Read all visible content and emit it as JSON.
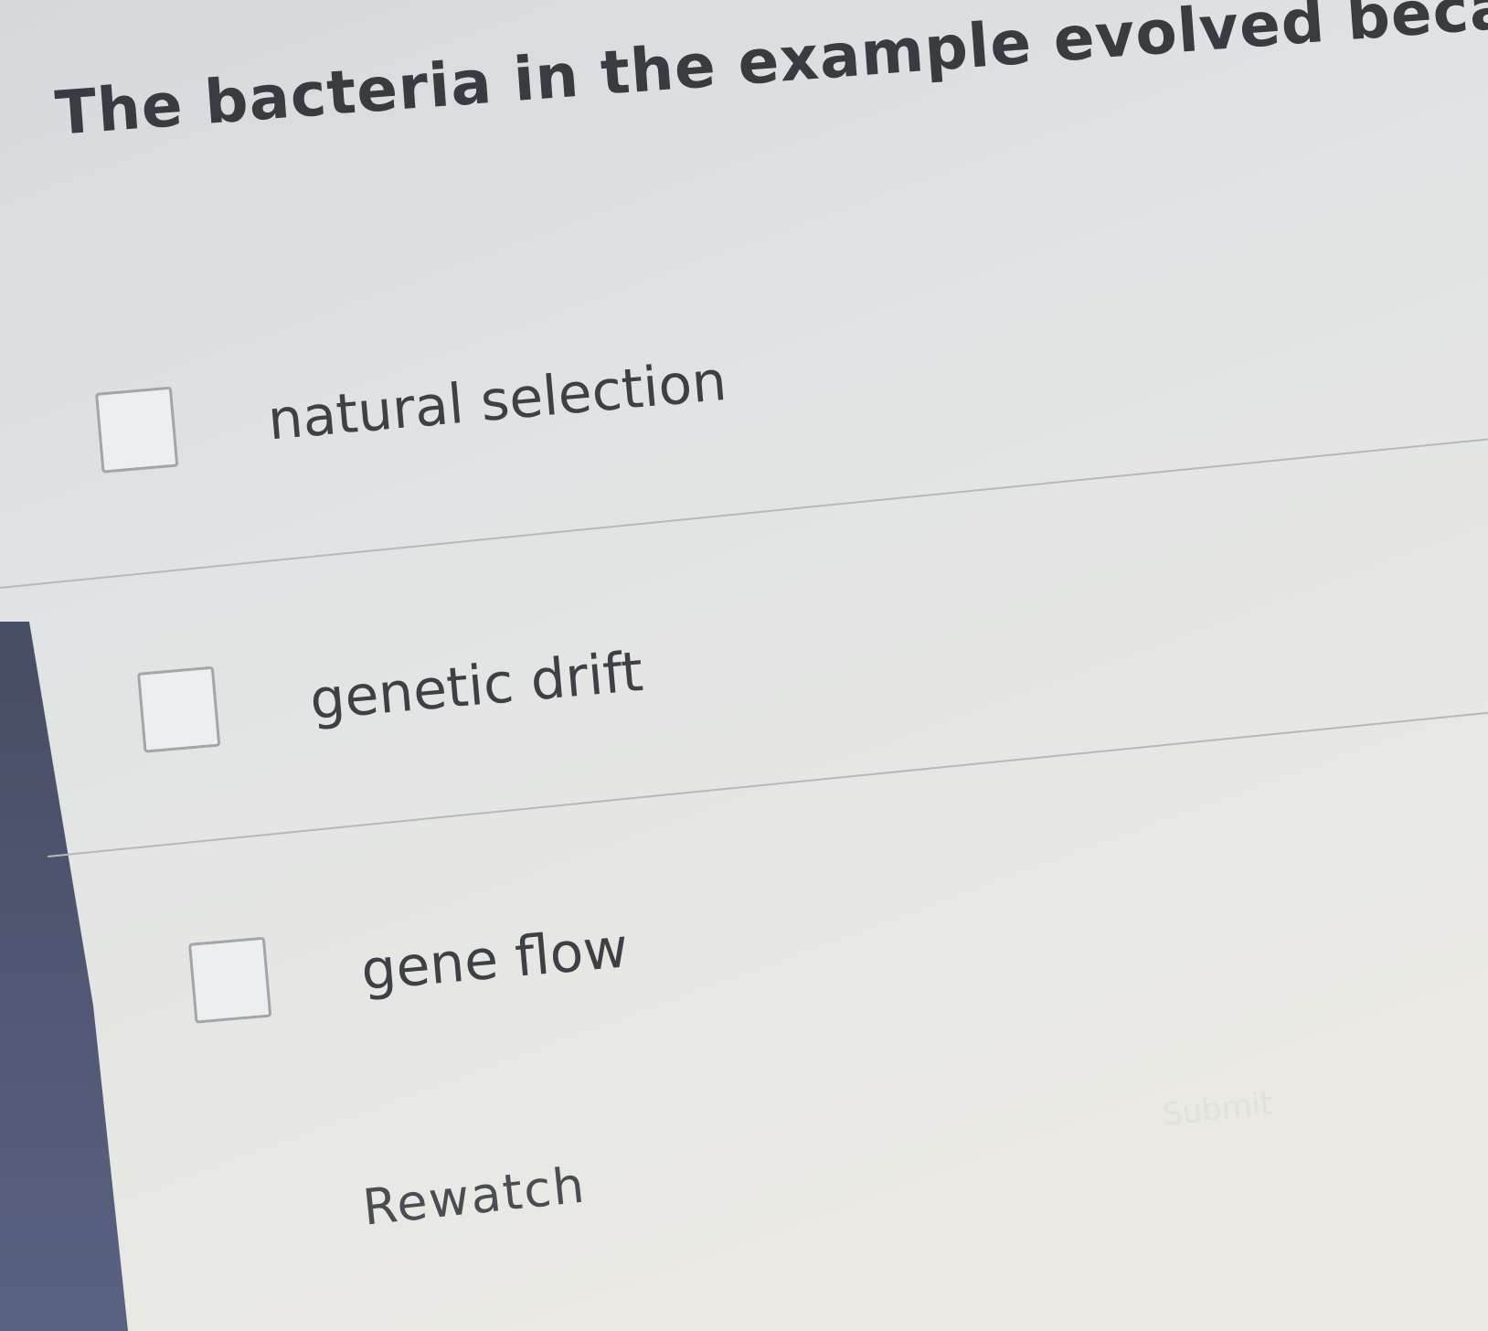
{
  "question": {
    "text": "The bacteria in the example evolved because of..."
  },
  "options": [
    {
      "label": "natural selection",
      "checked": false
    },
    {
      "label": "genetic drift",
      "checked": false
    },
    {
      "label": "gene flow",
      "checked": false
    }
  ],
  "actions": {
    "rewatch_label": "Rewatch",
    "submit_label": "Submit"
  }
}
